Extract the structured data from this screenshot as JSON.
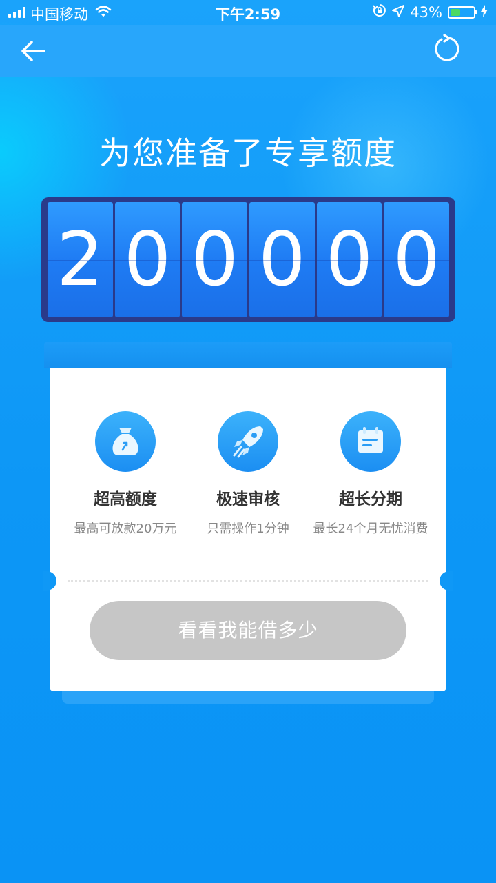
{
  "status_bar": {
    "carrier": "中国移动",
    "time": "下午2:59",
    "battery": "43%",
    "battery_level": 0.43
  },
  "nav": {
    "back_icon": "arrow-left-icon",
    "refresh_icon": "refresh-icon"
  },
  "headline": "为您准备了专享额度",
  "counter": {
    "digits": [
      "2",
      "0",
      "0",
      "0",
      "0",
      "0"
    ]
  },
  "features": [
    {
      "icon": "money-bag-icon",
      "title": "超高额度",
      "desc": "最高可放款20万元"
    },
    {
      "icon": "rocket-icon",
      "title": "极速审核",
      "desc": "只需操作1分钟"
    },
    {
      "icon": "calendar-icon",
      "title": "超长分期",
      "desc": "最长24个月无忧消费"
    }
  ],
  "cta": {
    "label": "看看我能借多少"
  },
  "colors": {
    "background": "#0a93f5",
    "nav_bar": "#28a6fb",
    "counter_frame": "#2a3a8a",
    "cta_disabled": "#c6c6c6",
    "battery_fill": "#4cd964"
  }
}
